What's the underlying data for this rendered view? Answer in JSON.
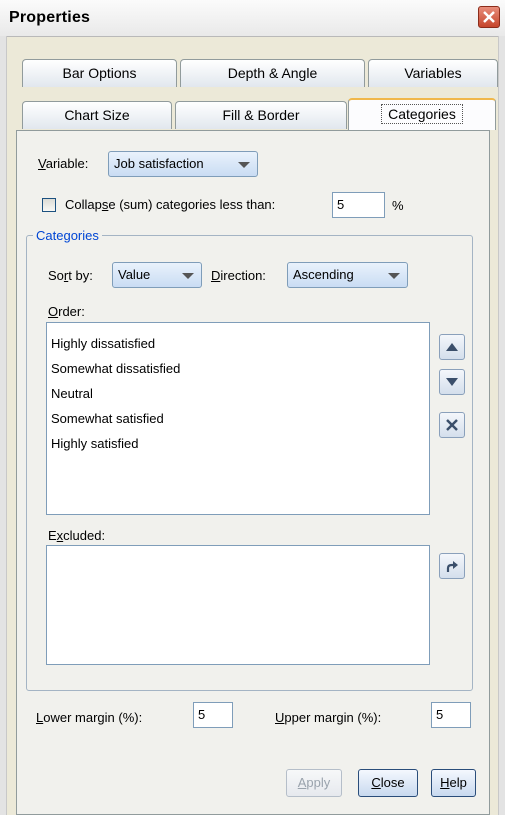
{
  "window": {
    "title": "Properties"
  },
  "tabs": {
    "row1": [
      "Bar Options",
      "Depth & Angle",
      "Variables"
    ],
    "row2": [
      "Chart Size",
      "Fill & Border",
      "Categories"
    ],
    "selected": "Categories"
  },
  "variable": {
    "label_pre": "",
    "label_accel": "V",
    "label_post": "ariable:",
    "value": "Job satisfaction"
  },
  "collapse": {
    "label_pre": "Collap",
    "label_accel": "s",
    "label_post": "e (sum) categories less than:",
    "value": "5",
    "unit": "%",
    "checked": false
  },
  "categories_group": {
    "title": "Categories",
    "sort_by": {
      "label_pre": "So",
      "label_accel": "r",
      "label_post": "t by:",
      "value": "Value"
    },
    "direction": {
      "label_pre": "",
      "label_accel": "D",
      "label_post": "irection:",
      "value": "Ascending"
    },
    "order": {
      "label_pre": "",
      "label_accel": "O",
      "label_post": "rder:",
      "items": [
        "Highly dissatisfied",
        "Somewhat dissatisfied",
        "Neutral",
        "Somewhat satisfied",
        "Highly satisfied"
      ]
    },
    "excluded": {
      "label_pre": "E",
      "label_accel": "x",
      "label_post": "cluded:",
      "items": []
    },
    "icons": [
      "move-up-icon",
      "move-down-icon",
      "exclude-icon",
      "restore-icon"
    ]
  },
  "margins": {
    "lower": {
      "label_pre": "",
      "label_accel": "L",
      "label_post": "ower margin (%):",
      "value": "5"
    },
    "upper": {
      "label_pre": "",
      "label_accel": "U",
      "label_post": "pper margin (%):",
      "value": "5"
    }
  },
  "buttons": {
    "apply": {
      "label_pre": "",
      "label_accel": "A",
      "label_post": "pply"
    },
    "close": {
      "label_pre": "",
      "label_accel": "C",
      "label_post": "lose"
    },
    "help": {
      "label_pre": "",
      "label_accel": "H",
      "label_post": "elp"
    }
  },
  "colors": {
    "group_title": "#0046d5",
    "close_button": "#c6452b",
    "selected_tab_accent": "#f0b74a"
  }
}
